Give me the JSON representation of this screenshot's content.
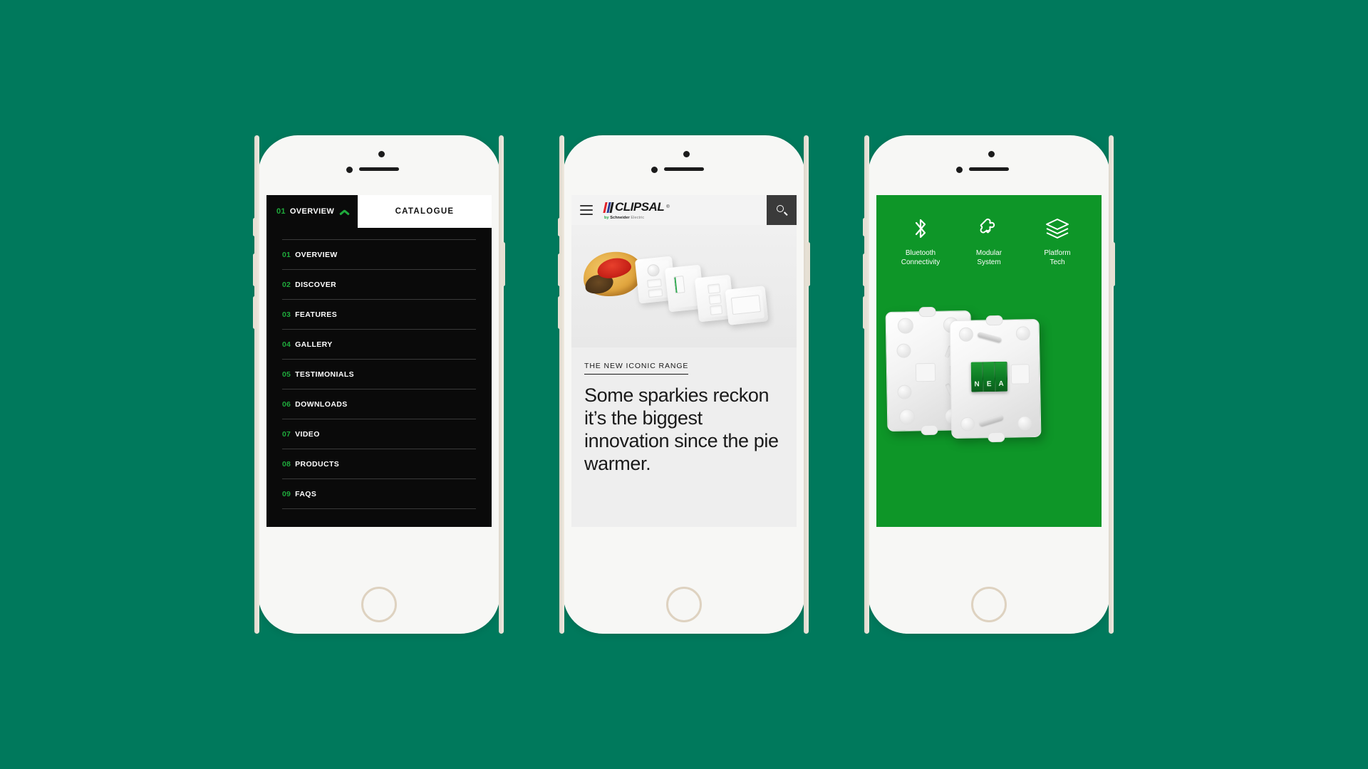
{
  "theme": {
    "page_background": "#00795C",
    "brand_green": "#0E9628",
    "accent_green": "#1FAA3C",
    "dark": "#0A0A0A"
  },
  "phone_nav": {
    "topbar": {
      "current_number": "01",
      "current_label": "OVERVIEW",
      "chevron_icon": "chevron-up-icon",
      "catalogue_label": "CATALOGUE"
    },
    "items": [
      {
        "num": "01",
        "label": "OVERVIEW"
      },
      {
        "num": "02",
        "label": "DISCOVER"
      },
      {
        "num": "03",
        "label": "FEATURES"
      },
      {
        "num": "04",
        "label": "GALLERY"
      },
      {
        "num": "05",
        "label": "TESTIMONIALS"
      },
      {
        "num": "06",
        "label": "DOWNLOADS"
      },
      {
        "num": "07",
        "label": "VIDEO"
      },
      {
        "num": "08",
        "label": "PRODUCTS"
      },
      {
        "num": "09",
        "label": "FAQS"
      }
    ]
  },
  "phone_content": {
    "header": {
      "menu_icon": "hamburger-menu-icon",
      "logo_word": "CLIPSAL",
      "logo_trademark": "®",
      "logo_tagline_by": "by",
      "logo_tagline_brand": "Schneider",
      "logo_tagline_rest": "Electric",
      "search_icon": "search-icon"
    },
    "hero": {
      "eyebrow": "THE NEW ICONIC RANGE",
      "headline": "Some sparkies reckon it’s the biggest innovation since the pie warmer."
    }
  },
  "phone_feature": {
    "features": [
      {
        "icon": "bluetooth-icon",
        "line1": "Bluetooth",
        "line2": "Connectivity"
      },
      {
        "icon": "puzzle-piece-icon",
        "line1": "Modular",
        "line2": "System"
      },
      {
        "icon": "layers-stack-icon",
        "line1": "Platform",
        "line2": "Tech"
      }
    ],
    "terminals": [
      "N",
      "E",
      "A"
    ]
  }
}
